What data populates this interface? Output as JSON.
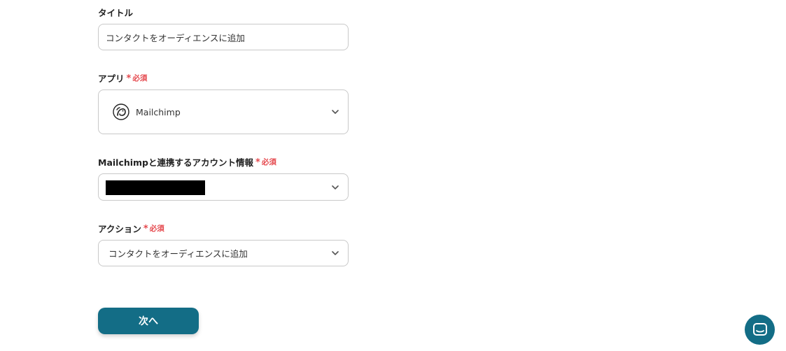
{
  "title_field": {
    "label": "タイトル",
    "value": "コンタクトをオーディエンスに追加"
  },
  "app_field": {
    "label": "アプリ",
    "required": "必須",
    "value": "Mailchimp",
    "icon": "mailchimp-logo"
  },
  "account_field": {
    "label": "Mailchimpと連携するアカウント情報",
    "required": "必須"
  },
  "action_field": {
    "label": "アクション",
    "required": "必須",
    "value": "コンタクトをオーディエンスに追加"
  },
  "buttons": {
    "next_label": "次へ"
  },
  "colors": {
    "primary": "#136d86",
    "required": "#e5484d",
    "border": "#c9c9c9"
  },
  "chat_widget": {
    "icon": "chat-icon"
  }
}
